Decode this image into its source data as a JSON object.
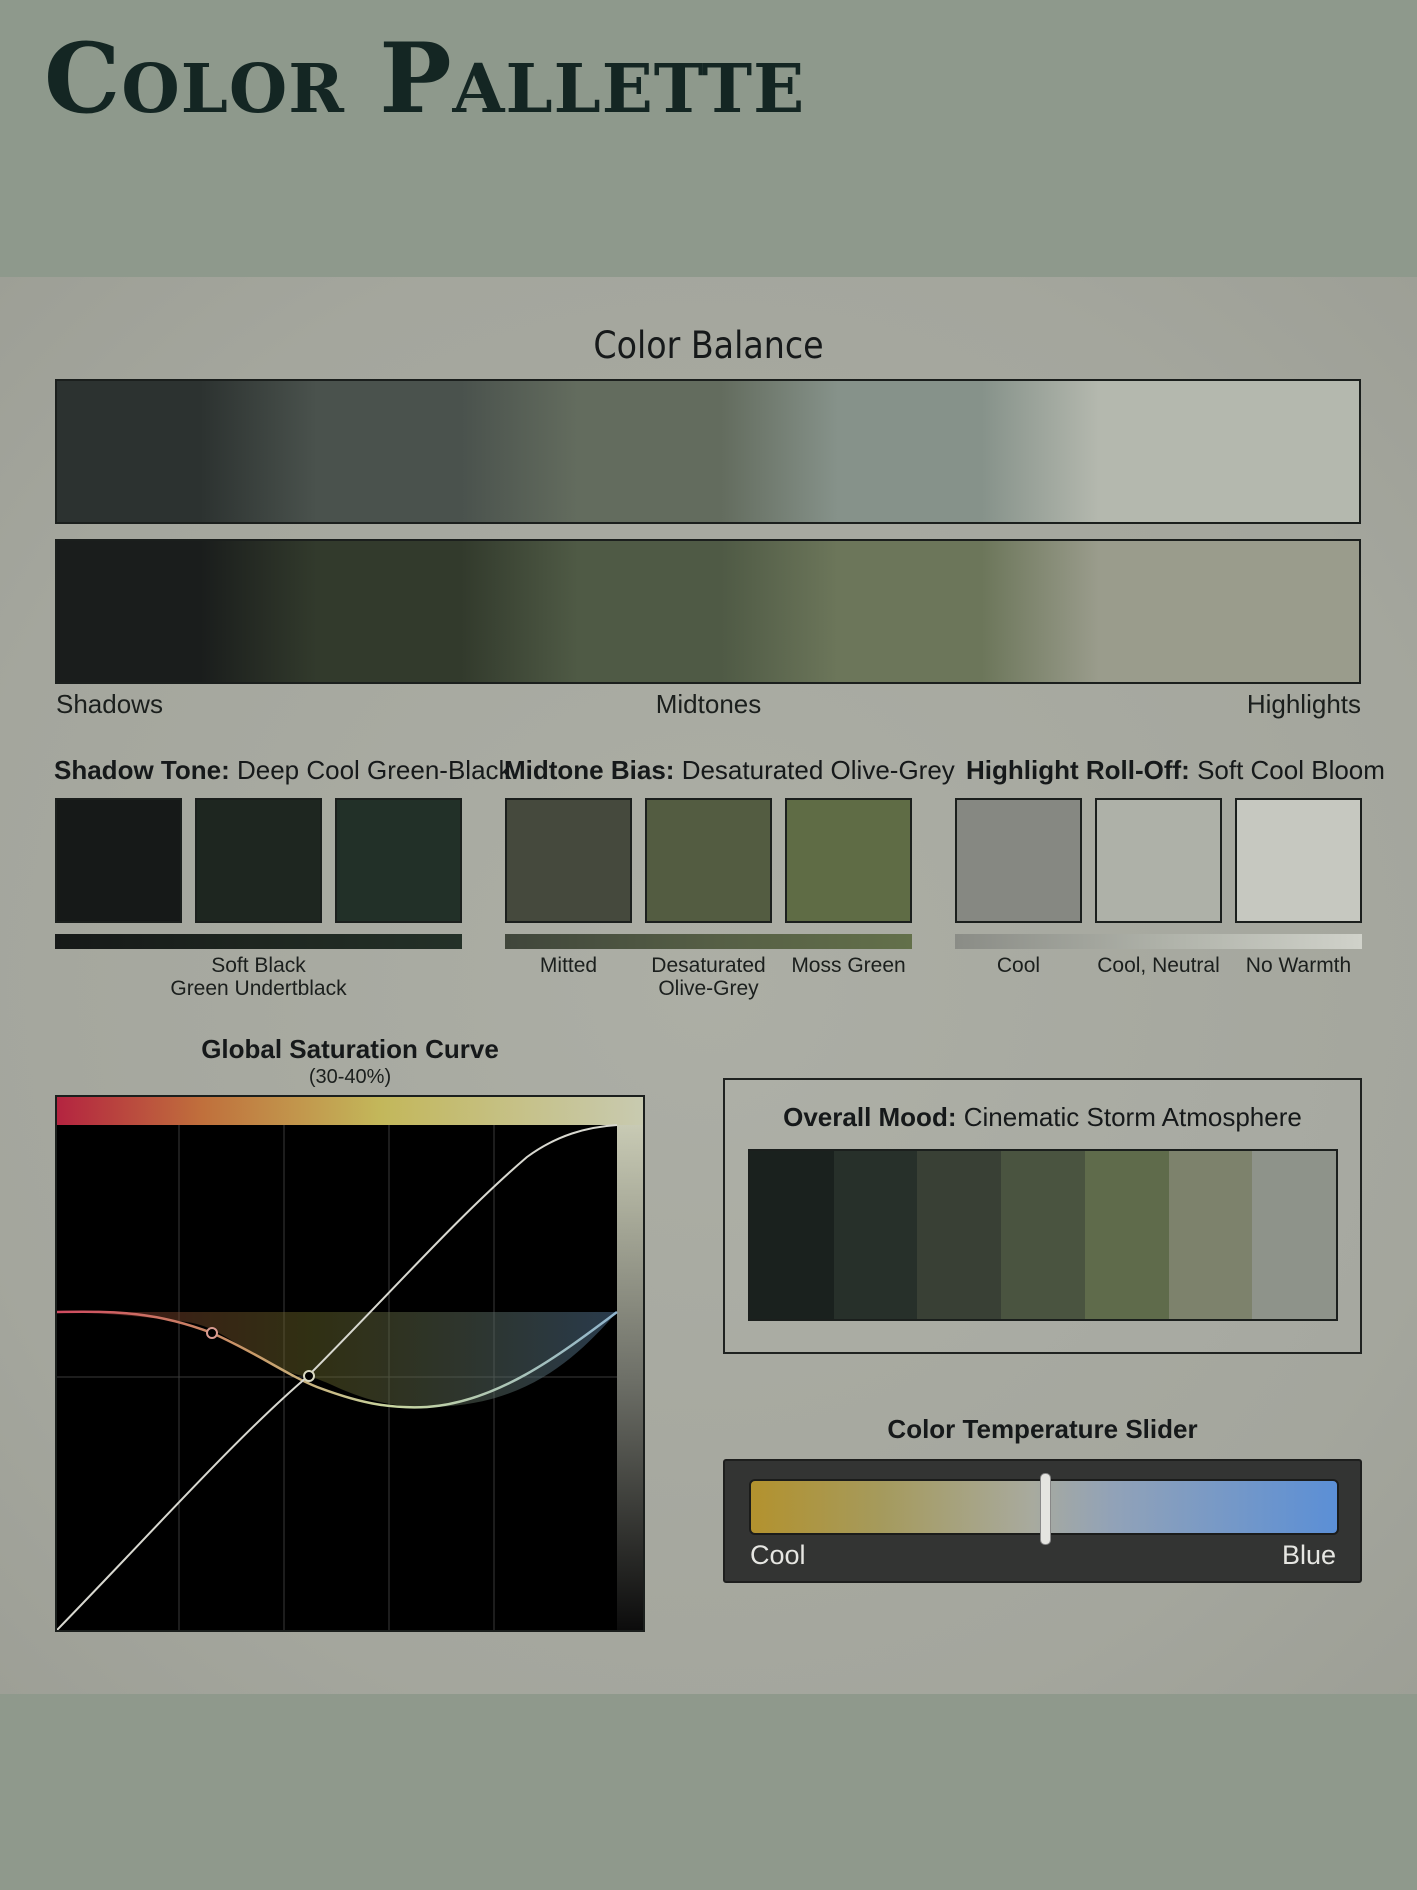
{
  "header": {
    "title": "Color Pallette"
  },
  "color_balance": {
    "title": "Color Balance",
    "labels": {
      "shadows": "Shadows",
      "midtones": "Midtones",
      "highlights": "Highlights"
    },
    "row1": [
      "#2c3230",
      "#4a524d",
      "#636c5e",
      "#86928a",
      "#b4b8ae"
    ],
    "row2": [
      "#1a1d1c",
      "#323a2c",
      "#4f5a45",
      "#6c765a",
      "#9a9c8c"
    ]
  },
  "tones": {
    "shadow": {
      "label": "Shadow Tone:",
      "value": "Deep Cool Green-Black",
      "swatches": [
        "#161918",
        "#1e2620",
        "#223028"
      ],
      "captions": [
        "Soft Black\nGreen Undertblack"
      ]
    },
    "midtone": {
      "label": "Midtone Bias:",
      "value": "Desaturated Olive-Grey",
      "swatches": [
        "#45493d",
        "#535c41",
        "#5f6c45"
      ],
      "captions": [
        "Mitted",
        "Desaturated\nOlive-Grey",
        "Moss Green"
      ]
    },
    "highlight": {
      "label": "Highlight Roll-Off:",
      "value": "Soft Cool Bloom",
      "swatches": [
        "#868882",
        "#aeb1a8",
        "#c6c8c0"
      ],
      "captions": [
        "Cool",
        "Cool, Neutral",
        "No Warmth"
      ]
    }
  },
  "saturation_curve": {
    "title": "Global Saturation Curve",
    "subtitle": "(30-40%)"
  },
  "mood": {
    "label": "Overall Mood:",
    "value": "Cinematic Storm Atmosphere",
    "swatches": [
      "#1a211e",
      "#27302a",
      "#394035",
      "#4a5440",
      "#5f6b4b",
      "#7d826c",
      "#8e938a"
    ]
  },
  "temperature": {
    "title": "Color Temperature Slider",
    "left_label": "Cool",
    "right_label": "Blue",
    "value_fraction": 0.5
  }
}
